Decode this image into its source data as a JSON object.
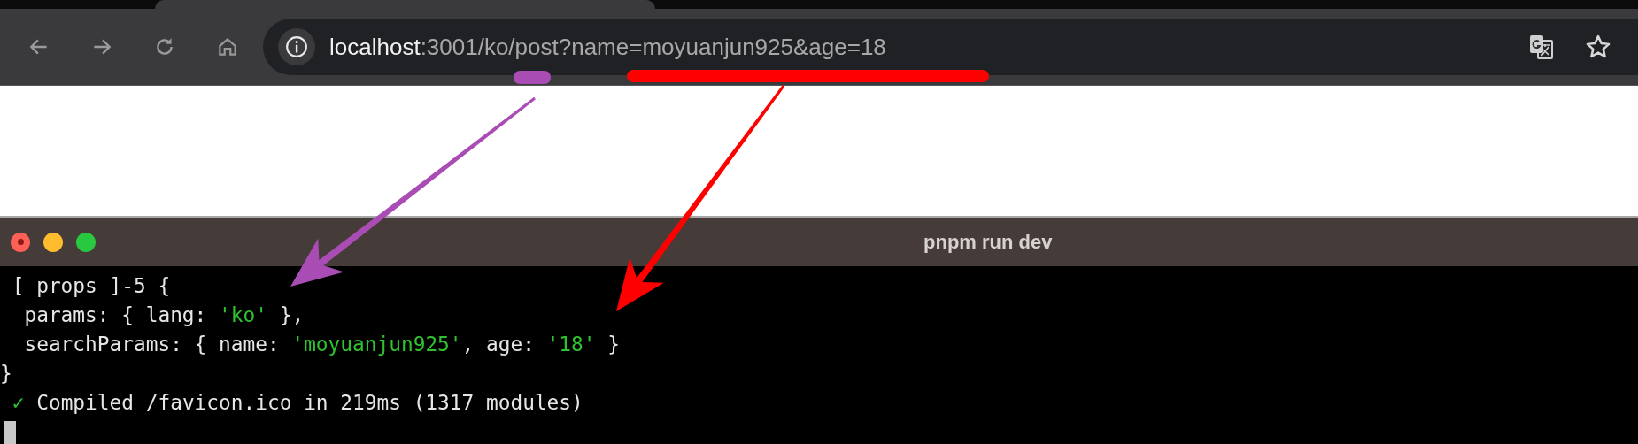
{
  "browser": {
    "url_host": "localhost",
    "url_path": ":3001/ko/post?name=moyuanjun925&age=18"
  },
  "annotations": [
    {
      "kind": "marker",
      "color": "#a94cb4"
    },
    {
      "kind": "underline",
      "color": "#ff0000"
    },
    {
      "kind": "arrow",
      "color": "#a94cb4"
    },
    {
      "kind": "arrow",
      "color": "#ff0000"
    }
  ],
  "terminal": {
    "title": "pnpm run dev",
    "lines": [
      {
        "segments": [
          {
            "kind": "plain",
            "text": " [ props ]-5 {"
          }
        ]
      },
      {
        "segments": [
          {
            "kind": "plain",
            "text": "  params: { lang: "
          },
          {
            "kind": "string",
            "text": "'ko'"
          },
          {
            "kind": "plain",
            "text": " },"
          }
        ]
      },
      {
        "segments": [
          {
            "kind": "plain",
            "text": "  searchParams: { name: "
          },
          {
            "kind": "string",
            "text": "'moyuanjun925'"
          },
          {
            "kind": "plain",
            "text": ", age: "
          },
          {
            "kind": "string",
            "text": "'18'"
          },
          {
            "kind": "plain",
            "text": " }"
          }
        ]
      },
      {
        "segments": [
          {
            "kind": "plain",
            "text": "}"
          }
        ]
      },
      {
        "segments": [
          {
            "kind": "ok",
            "text": " ✓"
          },
          {
            "kind": "plain",
            "text": " Compiled /favicon.ico in 219ms (1317 modules)"
          }
        ]
      }
    ],
    "cursor": true
  }
}
